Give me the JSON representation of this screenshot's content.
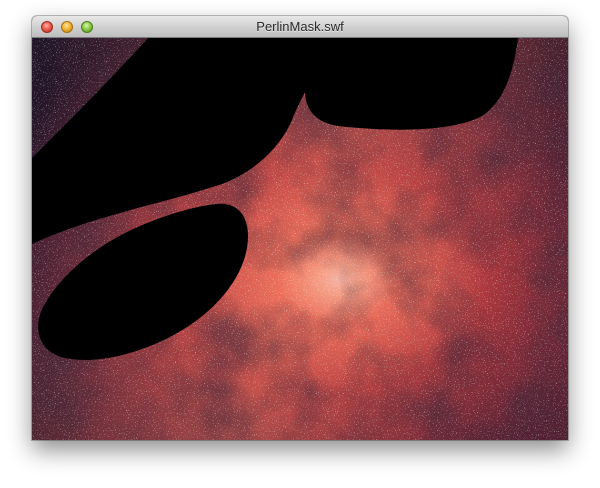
{
  "window": {
    "title": "PerlinMask.swf",
    "controls": {
      "close_color": "#ee5c4f",
      "minimize_color": "#f3b536",
      "zoom_color": "#8ccc49"
    }
  },
  "stage": {
    "image": "milky-way-galaxy-core",
    "mask": "perlin-noise-mask",
    "mask_color": "#000000"
  }
}
